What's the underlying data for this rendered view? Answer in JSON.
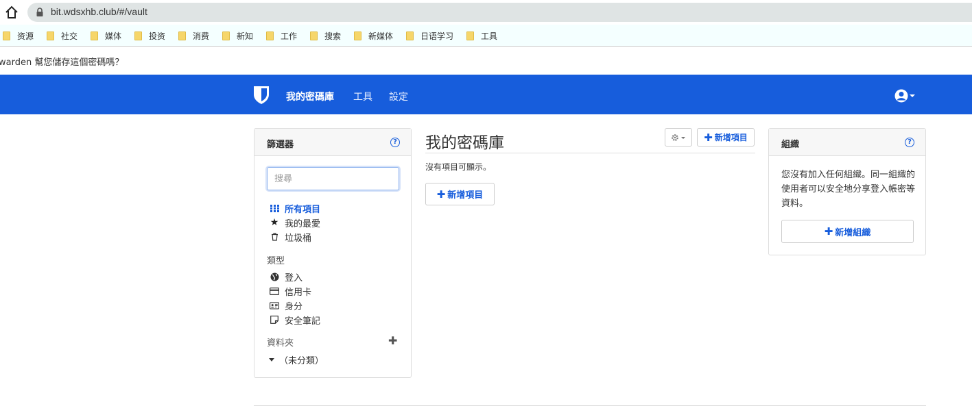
{
  "browser": {
    "url": "bit.wdsxhb.club/#/vault",
    "bookmarks": [
      "资源",
      "社交",
      "媒体",
      "投资",
      "消费",
      "新知",
      "工作",
      "搜索",
      "新媒体",
      "日语学习",
      "工具"
    ]
  },
  "prompt_bar": {
    "text": "warden 幫您儲存這個密碼嗎？"
  },
  "nav": {
    "vault": "我的密碼庫",
    "tools": "工具",
    "settings": "設定",
    "brand_color": "#175ddc"
  },
  "filters": {
    "title": "篩選器",
    "search_placeholder": "搜尋",
    "all_items": "所有項目",
    "favorites": "我的最愛",
    "trash": "垃圾桶",
    "types_label": "類型",
    "types": [
      "登入",
      "信用卡",
      "身分",
      "安全筆記"
    ],
    "folders_label": "資料夾",
    "no_folder": "（未分類）"
  },
  "main": {
    "title": "我的密碼庫",
    "add_item_header": "新增項目",
    "empty_message": "沒有項目可顯示。",
    "add_item": "新增項目"
  },
  "organizations": {
    "title": "組織",
    "description": "您沒有加入任何組織。同一組織的使用者可以安全地分享登入帳密等資料。",
    "new_org": "新增組織"
  }
}
